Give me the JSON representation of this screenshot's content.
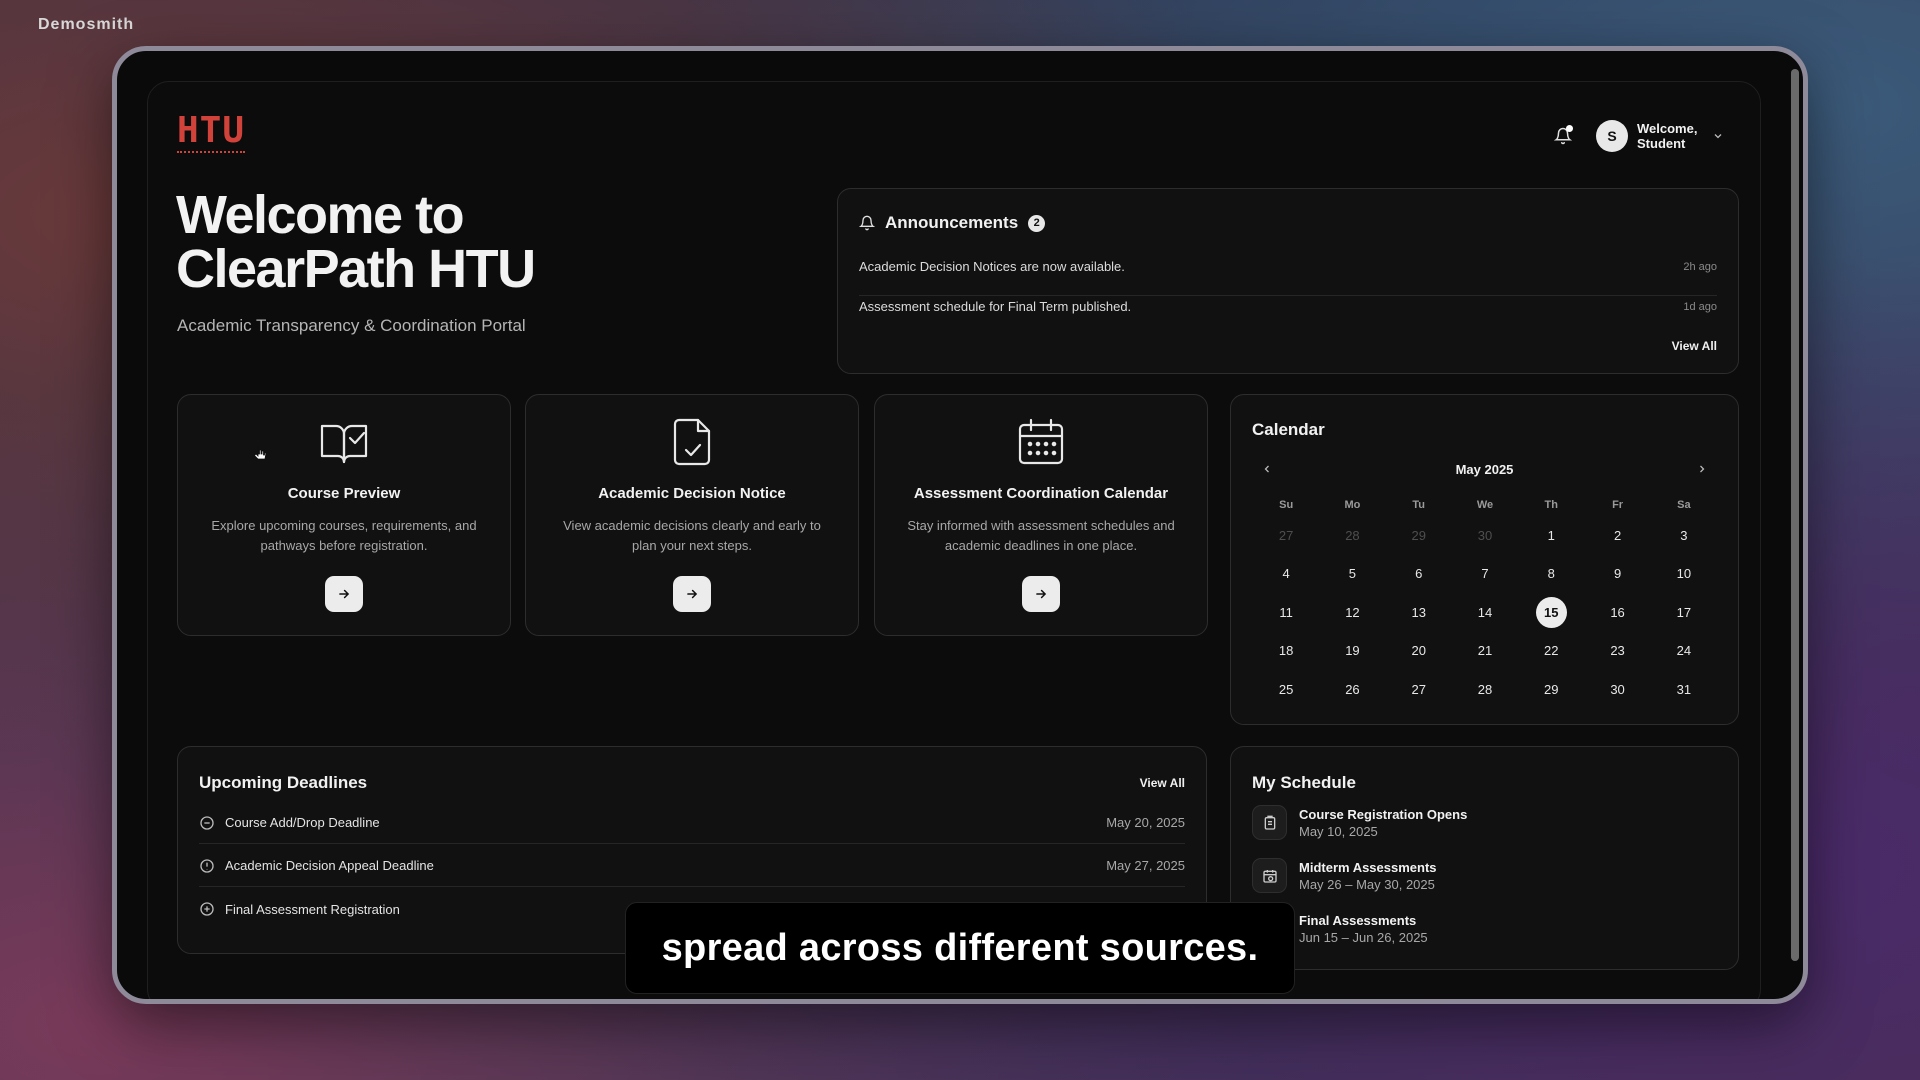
{
  "overlay": {
    "brand": "Demosmith",
    "caption": "spread across different sources."
  },
  "header": {
    "logo": "HTU",
    "user": {
      "initial": "S",
      "welcome": "Welcome, Student"
    }
  },
  "hero": {
    "title": "Welcome to ClearPath HTU",
    "subtitle": "Academic Transparency & Coordination Portal"
  },
  "announcements": {
    "title": "Announcements",
    "count": "2",
    "items": [
      {
        "text": "Academic Decision Notices are now available.",
        "time": "2h ago"
      },
      {
        "text": "Assessment schedule for Final Term published.",
        "time": "1d ago"
      }
    ],
    "view_all": "View All"
  },
  "features": [
    {
      "icon": "book-check-icon",
      "title": "Course Preview",
      "desc": "Explore upcoming courses, requirements, and pathways before registration."
    },
    {
      "icon": "file-check-icon",
      "title": "Academic Decision Notice",
      "desc": "View academic decisions clearly and early to plan your next steps."
    },
    {
      "icon": "calendar-icon",
      "title": "Assessment Coordination Calendar",
      "desc": "Stay informed with assessment schedules and academic deadlines in one place."
    }
  ],
  "calendar": {
    "title": "Calendar",
    "month": "May 2025",
    "weekdays": [
      "Su",
      "Mo",
      "Tu",
      "We",
      "Th",
      "Fr",
      "Sa"
    ],
    "days": [
      {
        "d": "27",
        "muted": true
      },
      {
        "d": "28",
        "muted": true
      },
      {
        "d": "29",
        "muted": true
      },
      {
        "d": "30",
        "muted": true
      },
      {
        "d": "1"
      },
      {
        "d": "2"
      },
      {
        "d": "3"
      },
      {
        "d": "4"
      },
      {
        "d": "5"
      },
      {
        "d": "6"
      },
      {
        "d": "7"
      },
      {
        "d": "8"
      },
      {
        "d": "9"
      },
      {
        "d": "10"
      },
      {
        "d": "11"
      },
      {
        "d": "12"
      },
      {
        "d": "13"
      },
      {
        "d": "14"
      },
      {
        "d": "15",
        "today": true
      },
      {
        "d": "16"
      },
      {
        "d": "17"
      },
      {
        "d": "18"
      },
      {
        "d": "19"
      },
      {
        "d": "20"
      },
      {
        "d": "21"
      },
      {
        "d": "22"
      },
      {
        "d": "23"
      },
      {
        "d": "24"
      },
      {
        "d": "25"
      },
      {
        "d": "26"
      },
      {
        "d": "27"
      },
      {
        "d": "28"
      },
      {
        "d": "29"
      },
      {
        "d": "30"
      },
      {
        "d": "31"
      }
    ]
  },
  "deadlines": {
    "title": "Upcoming Deadlines",
    "view_all": "View All",
    "items": [
      {
        "icon": "minus-circle-icon",
        "name": "Course Add/Drop Deadline",
        "date": "May 20, 2025"
      },
      {
        "icon": "alert-circle-icon",
        "name": "Academic Decision Appeal Deadline",
        "date": "May 27, 2025"
      },
      {
        "icon": "plus-circle-icon",
        "name": "Final Assessment Registration",
        "date": ""
      }
    ]
  },
  "schedule": {
    "title": "My Schedule",
    "items": [
      {
        "icon": "clipboard-icon",
        "name": "Course Registration Opens",
        "date": "May 10, 2025"
      },
      {
        "icon": "calendar-clock-icon",
        "name": "Midterm Assessments",
        "date": "May 26 – May 30, 2025"
      },
      {
        "icon": "calendar-icon",
        "name": "Final Assessments",
        "date": "Jun 15 – Jun 26, 2025"
      }
    ]
  }
}
